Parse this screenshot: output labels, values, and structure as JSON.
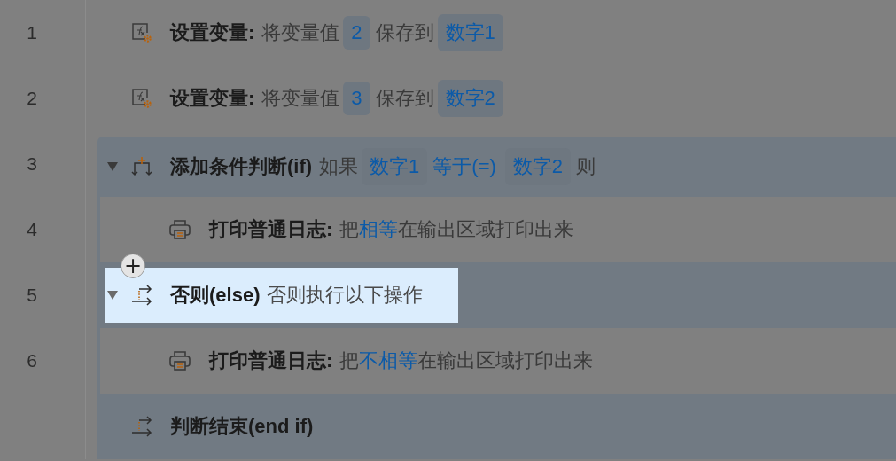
{
  "steps": [
    {
      "kind": "variable",
      "number": "1",
      "selected": false,
      "title": "设置变量:",
      "parts": [
        {
          "kind": "plain",
          "text": "将变量值"
        },
        {
          "kind": "chip",
          "text": "2"
        },
        {
          "kind": "plain",
          "text": "保存到"
        },
        {
          "kind": "chip",
          "text": "数字1"
        }
      ]
    },
    {
      "kind": "variable",
      "number": "2",
      "selected": false,
      "title": "设置变量:",
      "parts": [
        {
          "kind": "plain",
          "text": "将变量值"
        },
        {
          "kind": "chip",
          "text": "3"
        },
        {
          "kind": "plain",
          "text": "保存到"
        },
        {
          "kind": "chip",
          "text": "数字2"
        }
      ]
    },
    {
      "kind": "if",
      "number": "3",
      "selected": false,
      "expanded": true,
      "title": "添加条件判断(if)",
      "parts": [
        {
          "kind": "plain",
          "text": "如果"
        },
        {
          "kind": "chip",
          "text": "数字1"
        },
        {
          "kind": "link",
          "text": "等于(=)"
        },
        {
          "kind": "chip",
          "text": "数字2"
        },
        {
          "kind": "plain",
          "text": "则"
        }
      ],
      "children": [
        {
          "kind": "print",
          "number": "4",
          "selected": false,
          "title": "打印普通日志:",
          "text": "把**相等**在输出区域打印出来"
        }
      ]
    },
    {
      "kind": "else",
      "number": "5",
      "selected": true,
      "expanded": true,
      "title": "否则(else)",
      "parts": [
        {
          "kind": "plain",
          "text": "否则执行以下操作"
        }
      ],
      "children": [
        {
          "kind": "print",
          "number": "6",
          "selected": false,
          "title": "打印普通日志:",
          "text": "把**不相等**在输出区域打印出来"
        }
      ]
    },
    {
      "kind": "endif",
      "selected": false,
      "title": "判断结束(end if)"
    }
  ],
  "add_button": {
    "label": "+"
  }
}
